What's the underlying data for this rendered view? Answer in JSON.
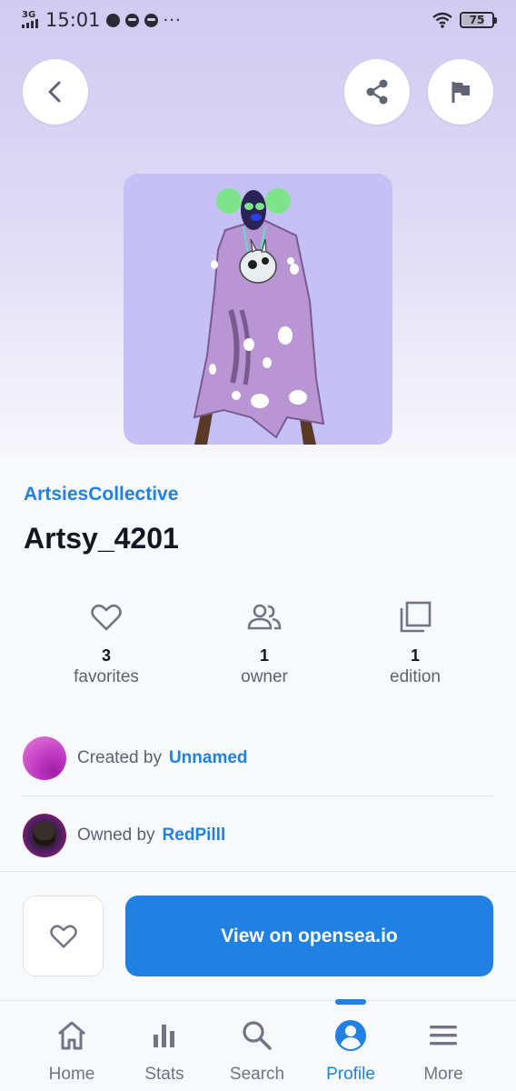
{
  "status_bar": {
    "network": "3G",
    "time": "15:01",
    "more_notifications": "···",
    "battery": "75"
  },
  "collection": "ArtsiesCollective",
  "title": "Artsy_4201",
  "stats": {
    "favorites": {
      "count": "3",
      "label": "favorites"
    },
    "owners": {
      "count": "1",
      "label": "owner"
    },
    "editions": {
      "count": "1",
      "label": "edition"
    }
  },
  "creator": {
    "prefix": "Created by",
    "name": "Unnamed"
  },
  "owner": {
    "prefix": "Owned by",
    "name": "RedPilll"
  },
  "actions": {
    "view_label": "View on opensea.io"
  },
  "tabs": [
    {
      "label": "Home",
      "icon": "home-icon"
    },
    {
      "label": "Stats",
      "icon": "bar-chart-icon"
    },
    {
      "label": "Search",
      "icon": "search-icon"
    },
    {
      "label": "Profile",
      "icon": "profile-icon",
      "active": true
    },
    {
      "label": "More",
      "icon": "menu-icon"
    }
  ],
  "colors": {
    "accent": "#2081e2",
    "hero_bg": "#d1cbf1",
    "image_bg": "#c5c1f6"
  }
}
